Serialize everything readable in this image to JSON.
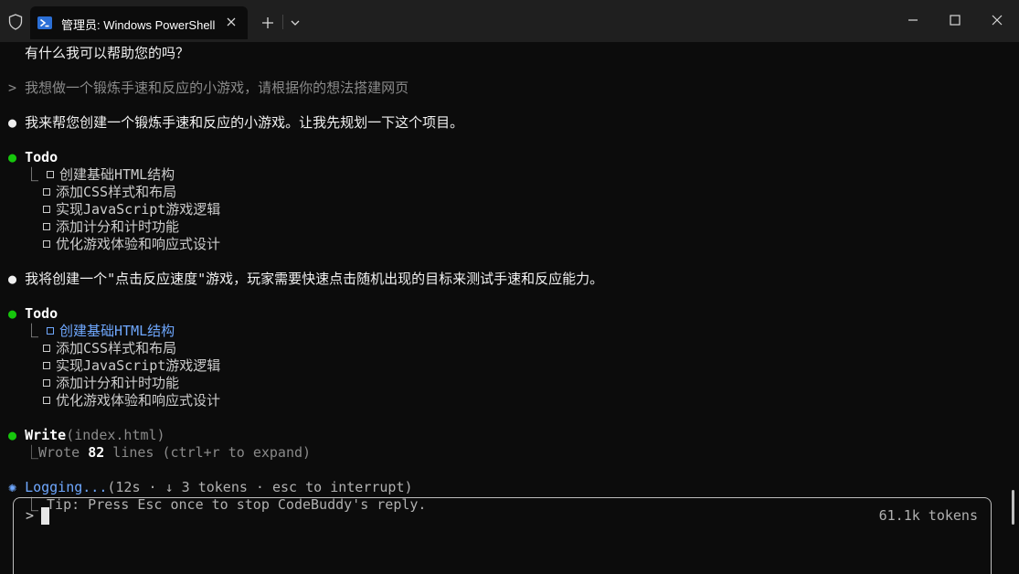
{
  "window": {
    "tab_title": "管理员: Windows PowerShell"
  },
  "lines": {
    "l0": "有什么我可以帮助您的吗？",
    "l1": "> 我想做一个锻炼手速和反应的小游戏，请根据你的想法搭建网页",
    "l2": "我来帮您创建一个锻炼手速和反应的小游戏。让我先规划一下这个项目。",
    "todo1_title": "Todo",
    "todo1_items": [
      "创建基础HTML结构",
      "添加CSS样式和布局",
      "实现JavaScript游戏逻辑",
      "添加计分和计时功能",
      "优化游戏体验和响应式设计"
    ],
    "l3": "我将创建一个\"点击反应速度\"游戏，玩家需要快速点击随机出现的目标来测试手速和反应能力。",
    "todo2_title": "Todo",
    "todo2_items": [
      "创建基础HTML结构",
      "添加CSS样式和布局",
      "实现JavaScript游戏逻辑",
      "添加计分和计时功能",
      "优化游戏体验和响应式设计"
    ],
    "write_tool": "Write",
    "write_arg": "(index.html)",
    "write_result_prefix": "Wrote ",
    "write_result_count": "82",
    "write_result_suffix": " lines (ctrl+r to expand)",
    "status_label": "Logging...",
    "status_detail": "(12s · ↓ 3 tokens · esc to interrupt)",
    "tip": "Tip: Press Esc once to stop CodeBuddy's reply."
  },
  "input": {
    "prompt": ">",
    "tokens": "61.1k tokens"
  },
  "colors": {
    "background": "#0c0c0c",
    "titlebar": "#1f1f1f",
    "bullet_green": "#16c60c",
    "accent_blue": "#6fa8ff"
  },
  "icons": {
    "shield": "shield-icon",
    "powershell": "powershell-icon",
    "close": "close-icon",
    "plus": "plus-icon",
    "chevron": "chevron-down-icon"
  }
}
